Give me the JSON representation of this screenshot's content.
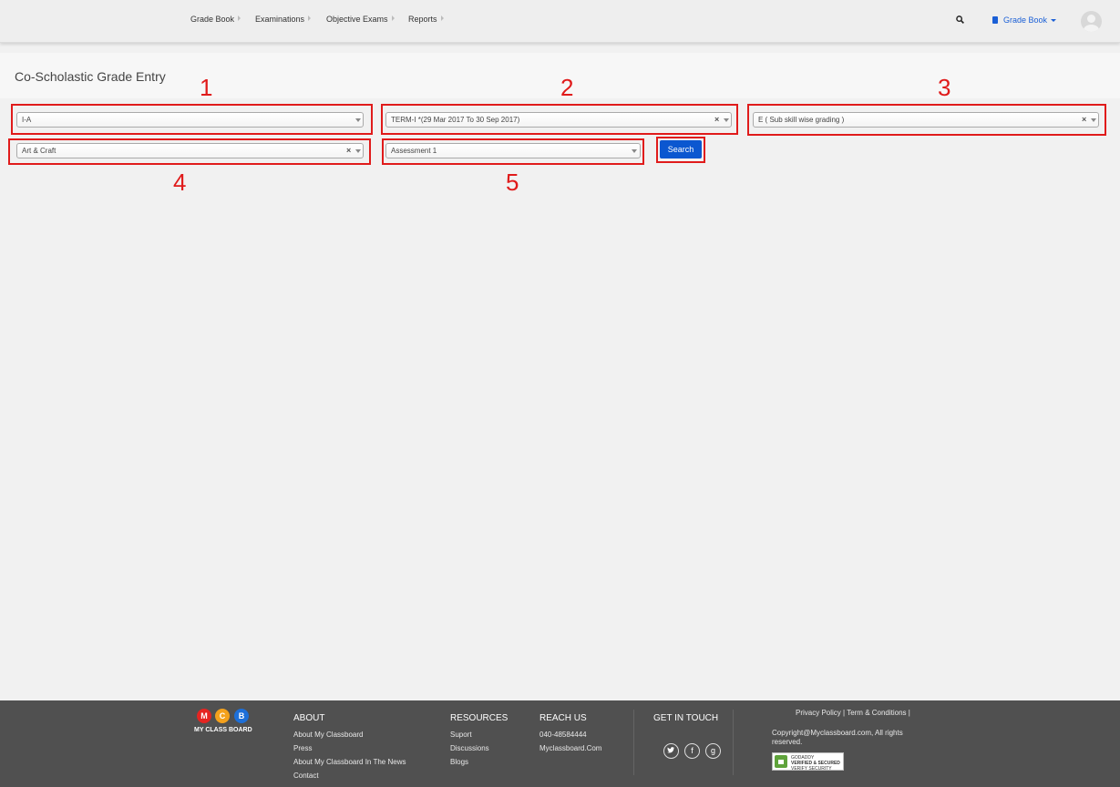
{
  "nav": {
    "items": [
      "Grade Book",
      "Examinations",
      "Objective Exams",
      "Reports"
    ],
    "right_menu_label": "Grade Book"
  },
  "page": {
    "title": "Co-Scholastic Grade Entry"
  },
  "form": {
    "class_select": "I-A",
    "term_select": "TERM-I *(29 Mar 2017 To 30 Sep 2017)",
    "grading_select": "E ( Sub skill wise grading )",
    "subject_select": "Art & Craft",
    "assessment_select": "Assessment 1",
    "search_label": "Search",
    "clear_glyph": "×"
  },
  "annotations": [
    "1",
    "2",
    "3",
    "4",
    "5"
  ],
  "annotation_color": "#e01b1b",
  "accent_color": "#0b57d0",
  "footer": {
    "logo_letters": [
      "M",
      "C",
      "B"
    ],
    "logo_text": "MY CLASS BOARD",
    "about": {
      "heading": "ABOUT",
      "links": [
        "About My Classboard",
        "Press",
        "About My Classboard In The News",
        "Contact"
      ]
    },
    "resources": {
      "heading": "RESOURCES",
      "links": [
        "Suport",
        "Discussions",
        "Blogs"
      ]
    },
    "reach": {
      "heading": "REACH US",
      "phone": "040-48584444",
      "site": "Myclassboard.Com"
    },
    "touch": {
      "heading": "GET IN TOUCH",
      "icons": [
        "twitter-icon",
        "facebook-icon",
        "google-plus-icon"
      ]
    },
    "legal": {
      "privacy": "Privacy Policy",
      "terms": "Term & Conditions",
      "sep": "|",
      "copyright": "Copyright@Myclassboard.com, All rights reserved.",
      "badge_top": "GODADDY",
      "badge_main": "VERIFIED & SECURED",
      "badge_sub": "VERIFY SECURITY"
    }
  }
}
